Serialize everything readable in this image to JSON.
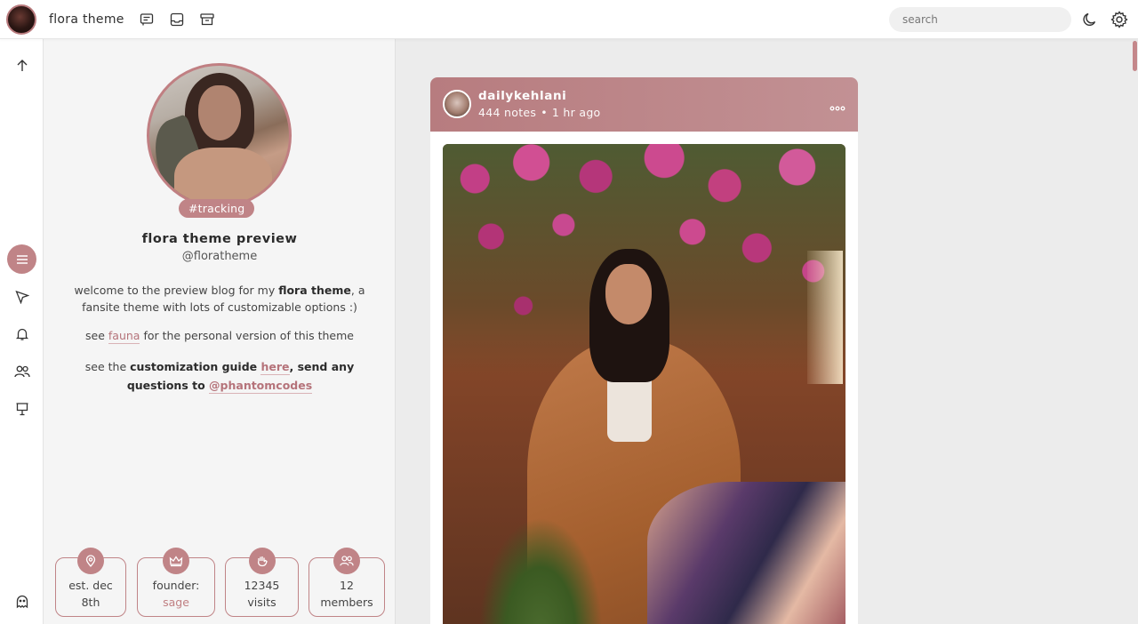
{
  "topbar": {
    "site_title": "flora theme",
    "search_placeholder": "search",
    "icons": [
      "message-icon",
      "inbox-icon",
      "archive-icon",
      "moon-icon",
      "gear-icon"
    ]
  },
  "rail": {
    "icons": [
      "arrow-up-icon",
      "menu-icon",
      "send-icon",
      "bell-icon",
      "people-icon",
      "board-icon",
      "ghost-icon"
    ],
    "active": "menu-icon"
  },
  "sidebar": {
    "tag": "#tracking",
    "blog_name": "flora theme preview",
    "handle": "@floratheme",
    "desc1_pre": "welcome to the preview blog for my ",
    "desc1_bold": "flora theme",
    "desc1_post": ", a fansite theme with lots of customizable options :)",
    "desc2_pre": "see ",
    "desc2_link": "fauna",
    "desc2_post": " for the personal version of this theme",
    "desc3_pre": "see the ",
    "desc3_bold": "customization guide ",
    "desc3_link": "here",
    "desc3_mid": ", send any questions to ",
    "desc3_link2": "@phantomcodes",
    "stats": [
      {
        "line1": "est. dec",
        "line2": "8th",
        "icon": "location-pin-icon"
      },
      {
        "line1": "founder:",
        "line2": "sage",
        "icon": "crown-icon"
      },
      {
        "line1": "12345",
        "line2": "visits",
        "icon": "wave-hand-icon"
      },
      {
        "line1": "12",
        "line2": "members",
        "icon": "members-icon"
      }
    ]
  },
  "post": {
    "username": "dailykehlani",
    "notes": "444 notes",
    "time": "1 hr ago"
  },
  "colors": {
    "accent": "#c08487",
    "header_gradient_start": "#b77c7f",
    "header_gradient_end": "#c29194"
  }
}
